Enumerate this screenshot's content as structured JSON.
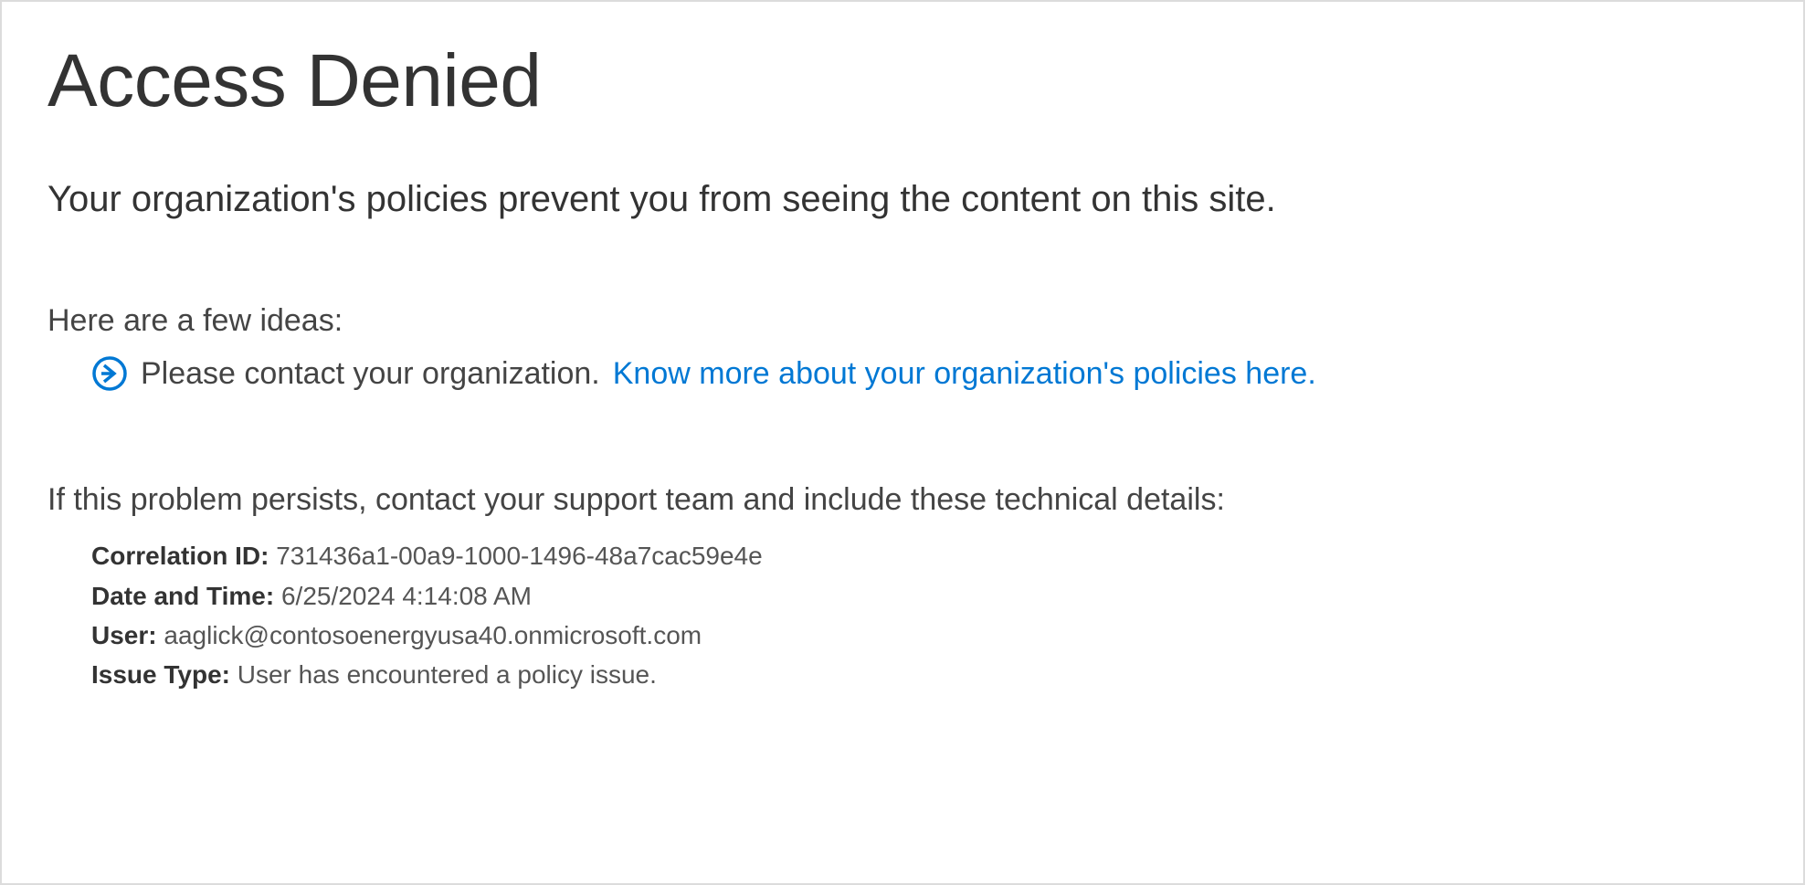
{
  "title": "Access Denied",
  "main_message": "Your organization's policies prevent you from seeing the content on this site.",
  "ideas_heading": "Here are a few ideas:",
  "idea_text": "Please contact your organization. ",
  "idea_link_text": "Know more about your organization's policies here.",
  "support_heading": "If this problem persists, contact your support team and include these technical details:",
  "details": {
    "correlation_id": {
      "label": "Correlation ID: ",
      "value": "731436a1-00a9-1000-1496-48a7cac59e4e"
    },
    "date_time": {
      "label": "Date and Time: ",
      "value": "6/25/2024 4:14:08 AM"
    },
    "user": {
      "label": "User: ",
      "value": "aaglick@contosoenergyusa40.onmicrosoft.com"
    },
    "issue_type": {
      "label": "Issue Type: ",
      "value": "User has encountered a policy issue."
    }
  },
  "colors": {
    "link": "#0078d4",
    "text": "#333333",
    "border": "#dcdcdc"
  }
}
